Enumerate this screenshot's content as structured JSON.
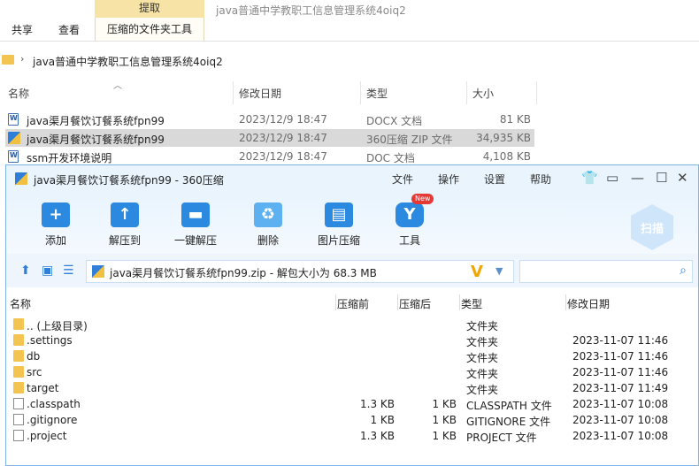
{
  "ribbon": {
    "tools_header": "提取",
    "window_title": "java普通中学教职工信息管理系统4oiq2",
    "tabs": [
      "共享",
      "查看",
      "压缩的文件夹工具"
    ]
  },
  "address": {
    "path": "java普通中学教职工信息管理系统4oiq2"
  },
  "file_list": {
    "columns": [
      "名称",
      "修改日期",
      "类型",
      "大小"
    ],
    "rows": [
      {
        "name": "java渠月餐饮订餐系统fpn99",
        "date": "2023/12/9 18:47",
        "type": "DOCX 文档",
        "size": "81 KB"
      },
      {
        "name": "java渠月餐饮订餐系统fpn99",
        "date": "2023/12/9 18:47",
        "type": "360压缩 ZIP 文件",
        "size": "34,935 KB"
      },
      {
        "name": "ssm开发环境说明",
        "date": "2023/12/9 18:47",
        "type": "DOC 文档",
        "size": "4,108 KB"
      }
    ]
  },
  "zip_window": {
    "title": "java渠月餐饮订餐系统fpn99 - 360压缩",
    "menus": [
      "文件",
      "操作",
      "设置",
      "帮助"
    ],
    "tools": [
      {
        "label": "添加",
        "icon": "add-icon"
      },
      {
        "label": "解压到",
        "icon": "extract-to-icon"
      },
      {
        "label": "一键解压",
        "icon": "one-click-extract-icon"
      },
      {
        "label": "删除",
        "icon": "delete-icon"
      },
      {
        "label": "图片压缩",
        "icon": "image-compress-icon"
      },
      {
        "label": "工具",
        "icon": "tools-icon"
      }
    ],
    "new_badge": "New",
    "scan_label": "扫描",
    "path_text": "java渠月餐饮订餐系统fpn99.zip - 解包大小为 68.3 MB",
    "columns": [
      "名称",
      "压缩前",
      "压缩后",
      "类型",
      "修改日期"
    ],
    "rows": [
      {
        "name": ".. (上级目录)",
        "before": "",
        "after": "",
        "type": "文件夹",
        "date": "",
        "kind": "folder"
      },
      {
        "name": ".settings",
        "before": "",
        "after": "",
        "type": "文件夹",
        "date": "2023-11-07 11:46",
        "kind": "folder"
      },
      {
        "name": "db",
        "before": "",
        "after": "",
        "type": "文件夹",
        "date": "2023-11-07 11:46",
        "kind": "folder"
      },
      {
        "name": "src",
        "before": "",
        "after": "",
        "type": "文件夹",
        "date": "2023-11-07 11:46",
        "kind": "folder"
      },
      {
        "name": "target",
        "before": "",
        "after": "",
        "type": "文件夹",
        "date": "2023-11-07 11:49",
        "kind": "folder"
      },
      {
        "name": ".classpath",
        "before": "1.3 KB",
        "after": "1 KB",
        "type": "CLASSPATH 文件",
        "date": "2023-11-07 10:08",
        "kind": "file"
      },
      {
        "name": ".gitignore",
        "before": "1 KB",
        "after": "1 KB",
        "type": "GITIGNORE 文件",
        "date": "2023-11-07 10:08",
        "kind": "file"
      },
      {
        "name": ".project",
        "before": "1.3 KB",
        "after": "1 KB",
        "type": "PROJECT 文件",
        "date": "2023-11-07 10:08",
        "kind": "file"
      }
    ]
  },
  "colors": {
    "accent": "#2b8ae0",
    "folder": "#f3c44f",
    "tools_header": "#f7e3a6",
    "selected_row": "#d9d9d9"
  }
}
